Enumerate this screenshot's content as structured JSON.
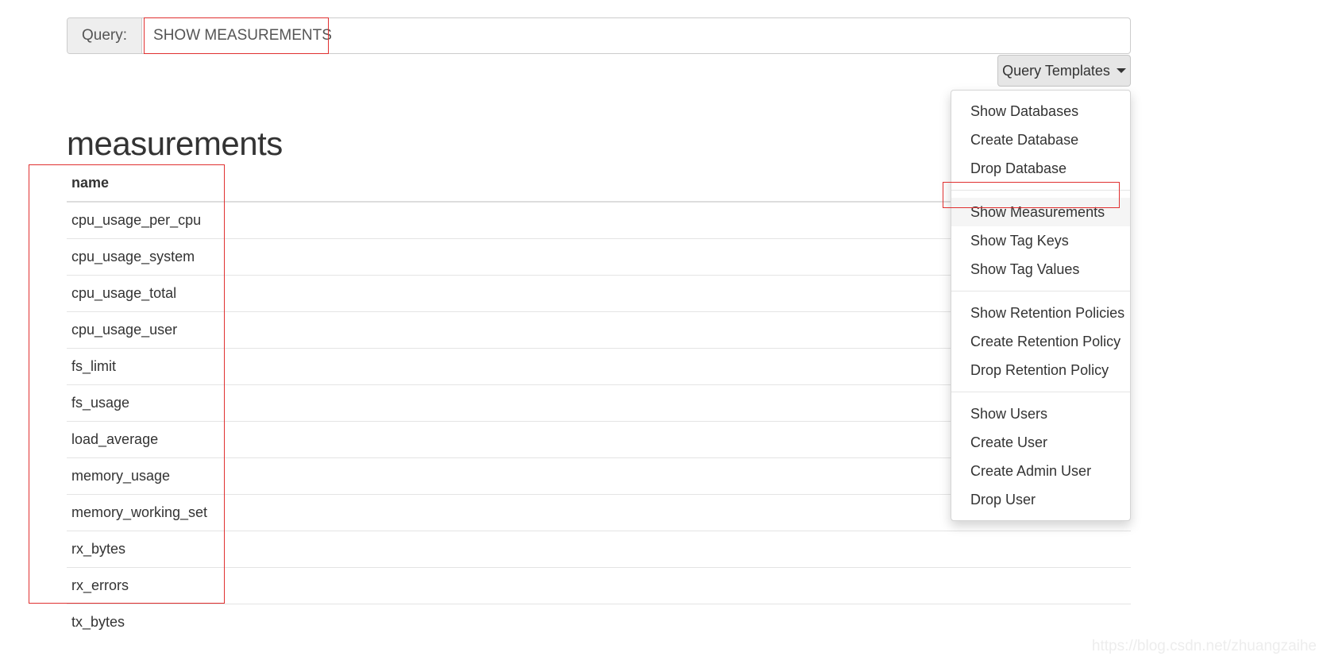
{
  "query_bar": {
    "label": "Query:",
    "value": "SHOW MEASUREMENTS",
    "placeholder": "Enter a query"
  },
  "templates_button": {
    "label": "Query Templates",
    "caret_icon": "caret-down-icon"
  },
  "dropdown": {
    "groups": [
      {
        "items": [
          {
            "label": "Show Databases",
            "active": false
          },
          {
            "label": "Create Database",
            "active": false
          },
          {
            "label": "Drop Database",
            "active": false
          }
        ]
      },
      {
        "items": [
          {
            "label": "Show Measurements",
            "active": true
          },
          {
            "label": "Show Tag Keys",
            "active": false
          },
          {
            "label": "Show Tag Values",
            "active": false
          }
        ]
      },
      {
        "items": [
          {
            "label": "Show Retention Policies",
            "active": false
          },
          {
            "label": "Create Retention Policy",
            "active": false
          },
          {
            "label": "Drop Retention Policy",
            "active": false
          }
        ]
      },
      {
        "items": [
          {
            "label": "Show Users",
            "active": false
          },
          {
            "label": "Create User",
            "active": false
          },
          {
            "label": "Create Admin User",
            "active": false
          },
          {
            "label": "Drop User",
            "active": false
          }
        ]
      }
    ]
  },
  "results": {
    "title": "measurements",
    "columns": [
      "name"
    ],
    "rows": [
      [
        "cpu_usage_per_cpu"
      ],
      [
        "cpu_usage_system"
      ],
      [
        "cpu_usage_total"
      ],
      [
        "cpu_usage_user"
      ],
      [
        "fs_limit"
      ],
      [
        "fs_usage"
      ],
      [
        "load_average"
      ],
      [
        "memory_usage"
      ],
      [
        "memory_working_set"
      ],
      [
        "rx_bytes"
      ],
      [
        "rx_errors"
      ],
      [
        "tx_bytes"
      ]
    ]
  },
  "watermark": {
    "text": "https://blog.csdn.net/zhuangzaihe"
  },
  "annotations": {
    "color": "#e03030",
    "boxes": [
      "query-value",
      "show-measurements-item",
      "name-column"
    ]
  }
}
